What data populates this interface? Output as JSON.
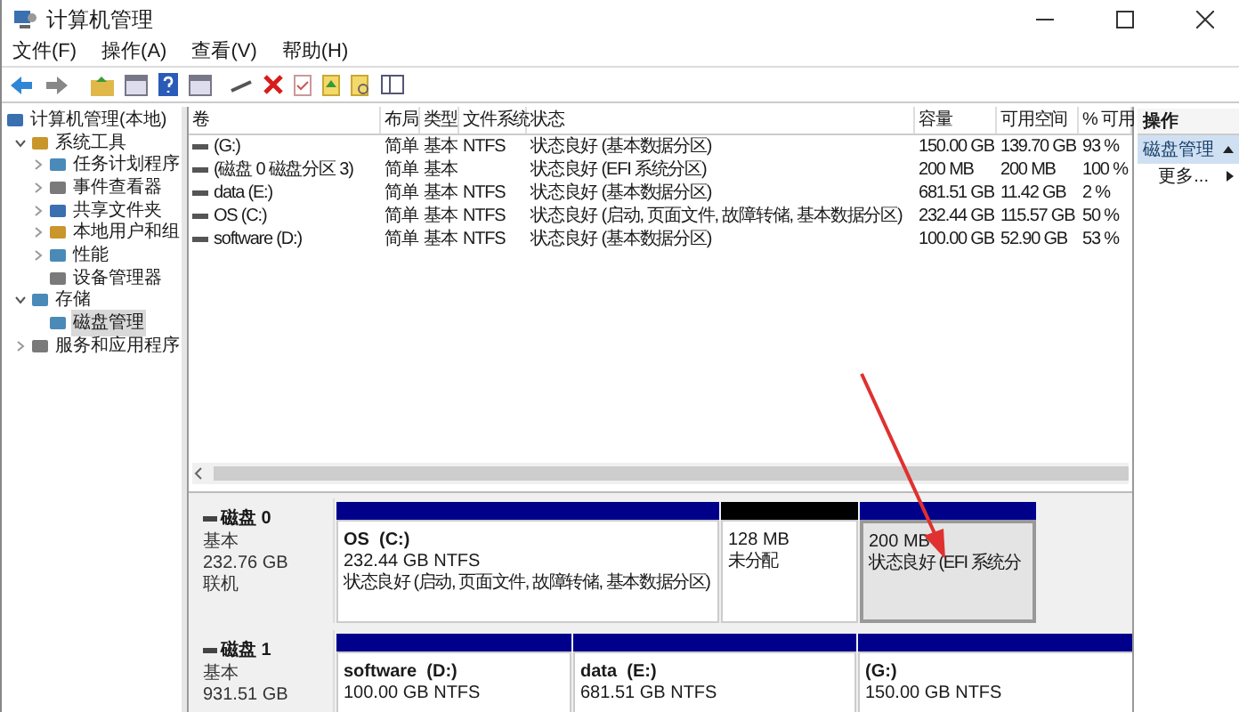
{
  "window": {
    "title": "计算机管理"
  },
  "menu": [
    "文件(F)",
    "操作(A)",
    "查看(V)",
    "帮助(H)"
  ],
  "tree": [
    {
      "label": "计算机管理(本地)",
      "selected": false,
      "children": [
        {
          "label": "系统工具",
          "expanded": true,
          "selected": false,
          "children": [
            {
              "label": "任务计划程序",
              "expanded": false,
              "selected": false
            },
            {
              "label": "事件查看器",
              "expanded": false,
              "selected": false
            },
            {
              "label": "共享文件夹",
              "expanded": false,
              "selected": false
            },
            {
              "label": "本地用户和组",
              "expanded": false,
              "selected": false
            },
            {
              "label": "性能",
              "expanded": false,
              "selected": false
            },
            {
              "label": "设备管理器",
              "selected": false
            }
          ]
        },
        {
          "label": "存储",
          "expanded": true,
          "selected": false,
          "children": [
            {
              "label": "磁盘管理",
              "selected": true
            }
          ]
        },
        {
          "label": "服务和应用程序",
          "expanded": false,
          "selected": false
        }
      ]
    }
  ],
  "table": {
    "columns": [
      "卷",
      "布局",
      "类型",
      "文件系统",
      "状态",
      "容量",
      "可用空间",
      "% 可用"
    ],
    "rows": [
      [
        "(G:)",
        "简单",
        "基本",
        "NTFS",
        "状态良好 (基本数据分区)",
        "150.00 GB",
        "139.70 GB",
        "93 %"
      ],
      [
        "(磁盘 0 磁盘分区 3)",
        "简单",
        "基本",
        "",
        "状态良好 (EFI 系统分区)",
        "200 MB",
        "200 MB",
        "100 %"
      ],
      [
        "data (E:)",
        "简单",
        "基本",
        "NTFS",
        "状态良好 (基本数据分区)",
        "681.51 GB",
        "11.42 GB",
        "2 %"
      ],
      [
        "OS (C:)",
        "简单",
        "基本",
        "NTFS",
        "状态良好 (启动, 页面文件, 故障转储, 基本数据分区)",
        "232.44 GB",
        "115.57 GB",
        "50 %"
      ],
      [
        "software (D:)",
        "简单",
        "基本",
        "NTFS",
        "状态良好 (基本数据分区)",
        "100.00 GB",
        "52.90 GB",
        "53 %"
      ]
    ]
  },
  "actions": {
    "title": "操作",
    "items": [
      {
        "label": "磁盘管理",
        "kind": "section"
      },
      {
        "label": "更多...",
        "kind": "submenu"
      }
    ]
  },
  "disks": [
    {
      "name": "磁盘 0",
      "type": "基本",
      "size": "232.76 GB",
      "status": "联机",
      "partitions": [
        {
          "kind": "primary",
          "name": "OS  (C:)",
          "size": "232.44 GB NTFS",
          "status": "状态良好 (启动, 页面文件, 故障转储, 基本数据分区)",
          "selected": false
        },
        {
          "kind": "unallocated",
          "size": "128 MB",
          "status": "未分配",
          "selected": false
        },
        {
          "kind": "primary",
          "size": "200 MB",
          "status": "状态良好 (EFI 系统分",
          "selected": true
        }
      ]
    },
    {
      "name": "磁盘 1",
      "type": "基本",
      "size": "931.51 GB",
      "partitions": [
        {
          "kind": "primary",
          "name": "software  (D:)",
          "size": "100.00 GB NTFS",
          "selected": false
        },
        {
          "kind": "primary",
          "name": "data  (E:)",
          "size": "681.51 GB NTFS",
          "selected": false
        },
        {
          "kind": "primary",
          "name": "(G:)",
          "size": "150.00 GB NTFS",
          "selected": false
        }
      ]
    }
  ]
}
